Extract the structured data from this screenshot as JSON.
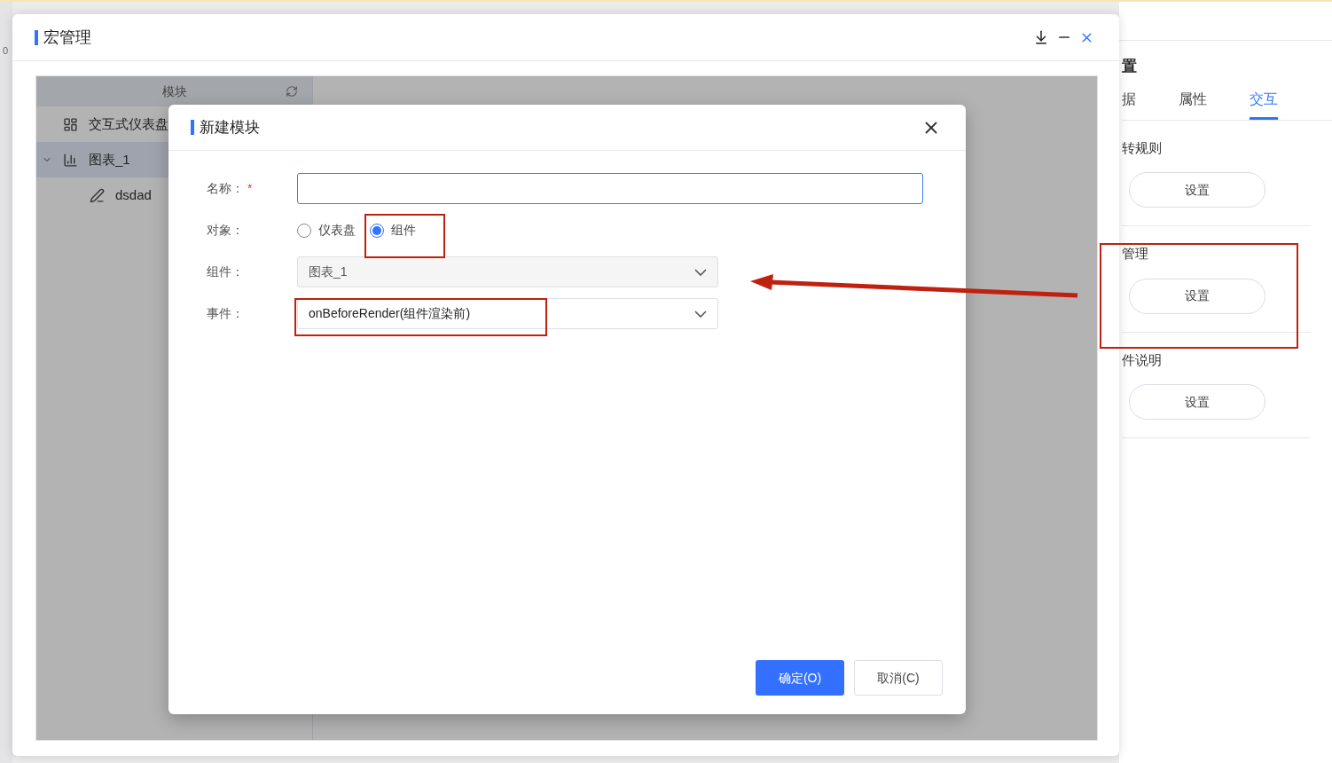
{
  "ruler": {
    "label": "0"
  },
  "side_panel": {
    "heading": "置",
    "tabs": [
      {
        "label": "据",
        "selected": false
      },
      {
        "label": "属性",
        "selected": false
      },
      {
        "label": "交互",
        "selected": true
      }
    ],
    "sections": [
      {
        "title": "转规则",
        "button": "设置"
      },
      {
        "title": "管理",
        "button": "设置"
      },
      {
        "title": "件说明",
        "button": "设置"
      }
    ]
  },
  "window": {
    "title": "宏管理"
  },
  "module_panel": {
    "header": "模块",
    "items": [
      {
        "label": "交互式仪表盘",
        "kind": "dashboard",
        "selected": false
      },
      {
        "label": "图表_1",
        "kind": "chart",
        "selected": true,
        "expanded": true,
        "children": [
          {
            "label": "dsdad",
            "kind": "script",
            "selected": false
          }
        ]
      }
    ]
  },
  "dialog": {
    "title": "新建模块",
    "fields": [
      {
        "kind": "text",
        "label": "名称：",
        "required_mark": "*"
      },
      {
        "kind": "radio",
        "label": "对象：",
        "options": [
          {
            "label": "仪表盘",
            "selected": false
          },
          {
            "label": "组件",
            "selected": true
          }
        ]
      },
      {
        "kind": "select",
        "label": "组件：",
        "value": "图表_1",
        "disabled": true
      },
      {
        "kind": "select",
        "label": "事件：",
        "value": "onBeforeRender(组件渲染前)",
        "disabled": false
      }
    ],
    "buttons": [
      {
        "label": "确定(O)",
        "kind": "primary"
      },
      {
        "label": "取消(C)",
        "kind": "default"
      }
    ]
  }
}
